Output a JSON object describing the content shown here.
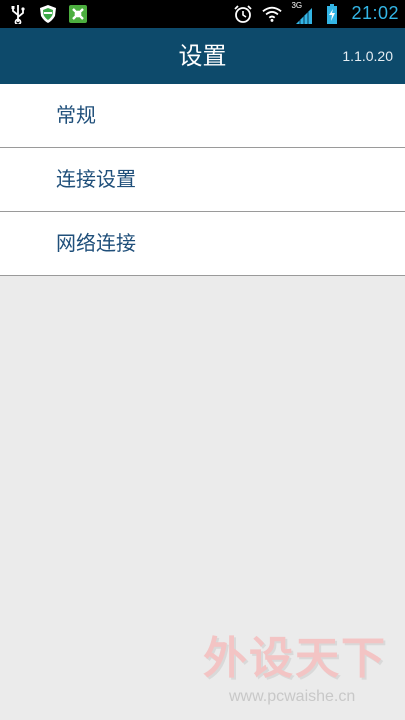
{
  "status_bar": {
    "time": "21:02",
    "network": "3G",
    "icons": [
      "usb-icon",
      "shield-app-icon",
      "green-app-icon",
      "alarm-icon",
      "wifi-icon",
      "signal-icon",
      "battery-charging-icon"
    ]
  },
  "header": {
    "title": "设置",
    "version": "1.1.0.20"
  },
  "menu": {
    "items": [
      {
        "label": "常规"
      },
      {
        "label": "连接设置"
      },
      {
        "label": "网络连接"
      }
    ]
  },
  "watermark": {
    "brand": "外设天下",
    "url": "www.pcwaishe.cn"
  },
  "colors": {
    "header_bg": "#0d4a6b",
    "accent": "#33b5e5",
    "item_text": "#1f4f7a",
    "background": "#ebebeb"
  }
}
